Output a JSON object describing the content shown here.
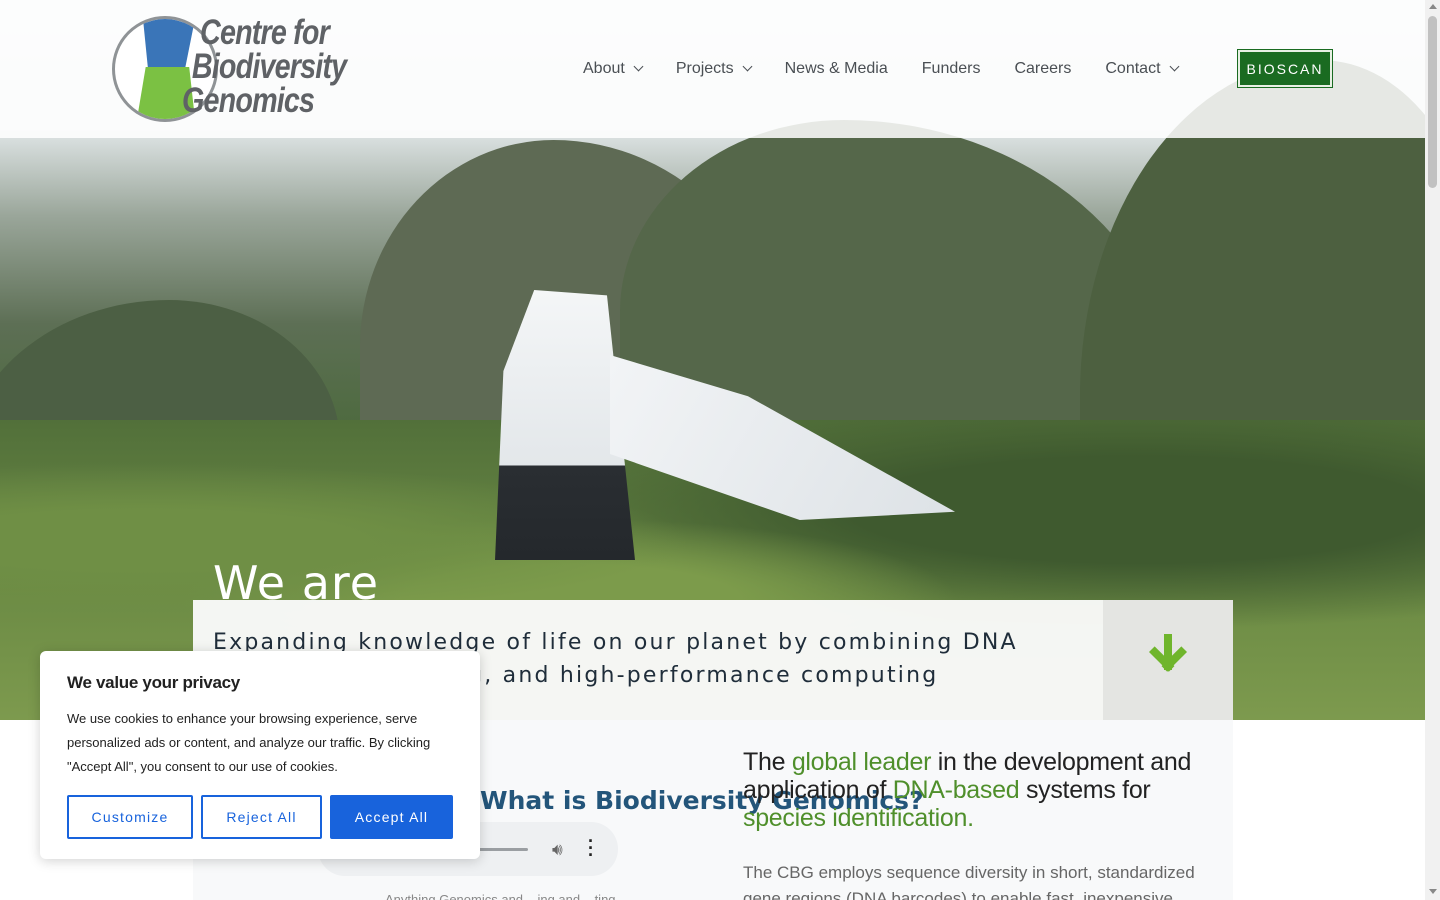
{
  "header": {
    "logo_lines": [
      "Centre for",
      "Biodiversity",
      "Genomics"
    ],
    "nav": [
      {
        "label": "About",
        "has_dropdown": true
      },
      {
        "label": "Projects",
        "has_dropdown": true
      },
      {
        "label": "News & Media",
        "has_dropdown": false
      },
      {
        "label": "Funders",
        "has_dropdown": false
      },
      {
        "label": "Careers",
        "has_dropdown": false
      },
      {
        "label": "Contact",
        "has_dropdown": true
      }
    ],
    "cta_label": "BIOSCAN"
  },
  "hero": {
    "heading": "We are",
    "tagline": "Expanding knowledge of life on our planet by combining DNA sequencing, imaging, and high-performance computing",
    "scroll_icon": "arrow-down-icon"
  },
  "main": {
    "question": "What is Biodiversity Genomics?",
    "audio_player": {
      "volume_icon": "volume-icon",
      "more_icon": "more-vertical-icon"
    },
    "transcript_snippet": "Anything Genomics and ...ing and ...ting ...",
    "lead_parts": [
      {
        "text": "The ",
        "green": false
      },
      {
        "text": "global leader",
        "green": true
      },
      {
        "text": " in the development and application of ",
        "green": false
      },
      {
        "text": "DNA-based",
        "green": true
      },
      {
        "text": " systems for ",
        "green": false
      },
      {
        "text": "species identification.",
        "green": true
      }
    ],
    "body": "The CBG employs sequence diversity in short, standardized gene regions (DNA barcodes) to enable fast, inexpensive"
  },
  "cookie_banner": {
    "title": "We value your privacy",
    "text": "We use cookies to enhance your browsing experience, serve personalized ads or content, and analyze our traffic. By clicking \"Accept All\", you consent to our use of cookies.",
    "customize_label": "Customize",
    "reject_label": "Reject All",
    "accept_label": "Accept All"
  },
  "colors": {
    "brand_green": "#1a6b21",
    "accent_green": "#4f8f2b",
    "arrow_green": "#6fb52c",
    "heading_blue": "#23557a",
    "cookie_blue": "#1863dc"
  }
}
